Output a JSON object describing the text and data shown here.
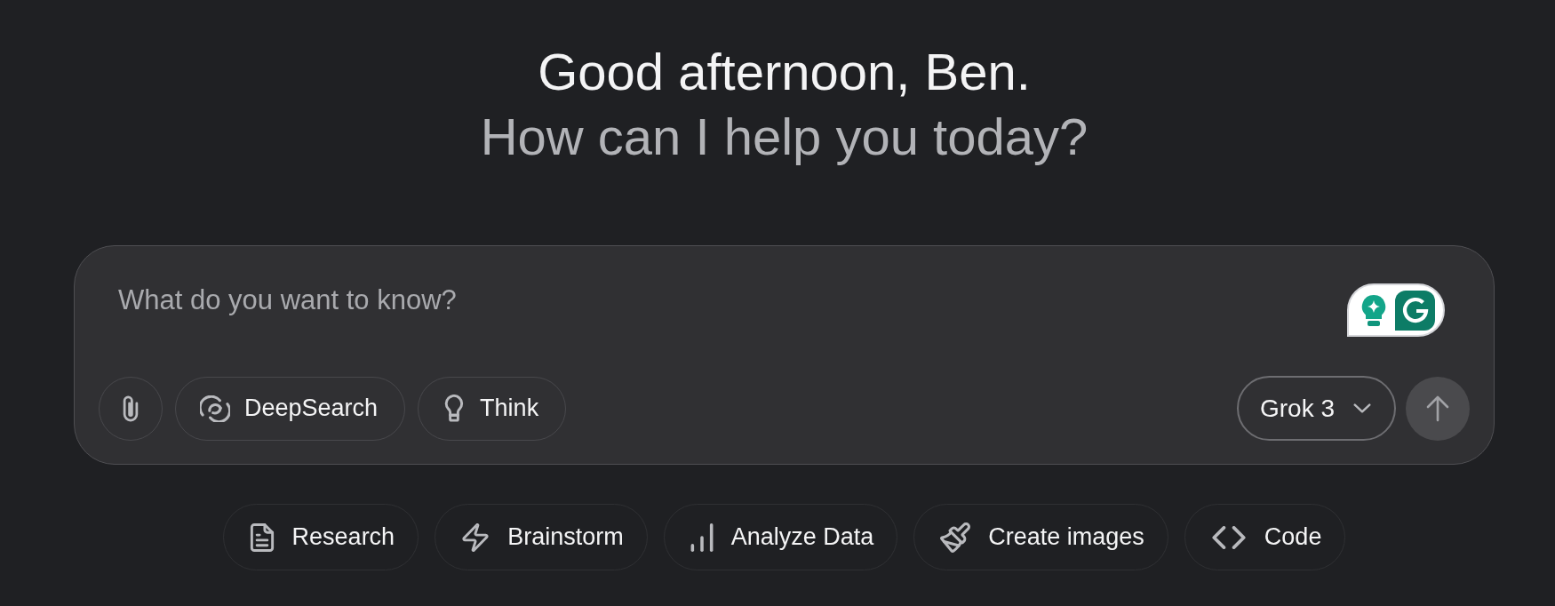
{
  "greeting": {
    "title": "Good afternoon, Ben.",
    "subtitle": "How can I help you today?"
  },
  "composer": {
    "placeholder": "What do you want to know?",
    "mode_buttons": [
      {
        "label": "DeepSearch"
      },
      {
        "label": "Think"
      }
    ],
    "model_selector": {
      "label": "Grok 3"
    }
  },
  "suggestions": [
    {
      "label": "Research"
    },
    {
      "label": "Brainstorm"
    },
    {
      "label": "Analyze Data"
    },
    {
      "label": "Create images"
    },
    {
      "label": "Code"
    }
  ]
}
